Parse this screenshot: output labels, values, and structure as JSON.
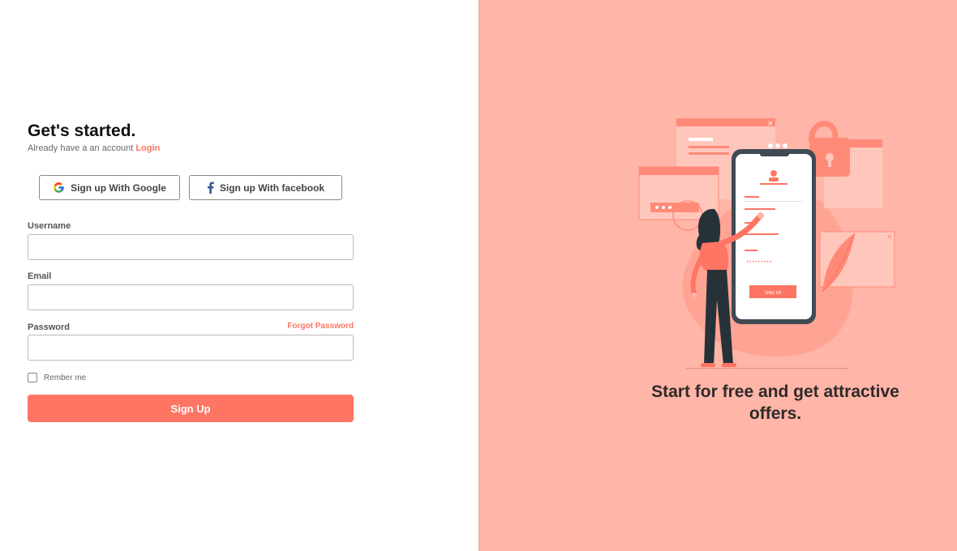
{
  "form": {
    "title": "Get's started.",
    "subtitle_prefix": "Already have a an account ",
    "login_link": "Login",
    "google_button": "Sign up With Google",
    "facebook_button": "Sign up With facebook",
    "username_label": "Username",
    "username_value": "",
    "email_label": "Email",
    "email_value": "",
    "password_label": "Password",
    "password_value": "",
    "forgot_password": "Forgot Password",
    "remember_label": "Rember me",
    "remember_checked": false,
    "signup_button": "Sign Up"
  },
  "promo": {
    "tagline": "Start for free and get attractive offers.",
    "phone_button": "SING UP",
    "password_dots": "•••••••••"
  },
  "colors": {
    "accent": "#ff7563",
    "panel_bg": "#ffb5a7",
    "google_blue": "#4285f4",
    "facebook_blue": "#3b5998"
  },
  "icons": {
    "google": "google-logo-icon",
    "facebook": "facebook-logo-icon",
    "checkbox": "checkbox-icon"
  }
}
